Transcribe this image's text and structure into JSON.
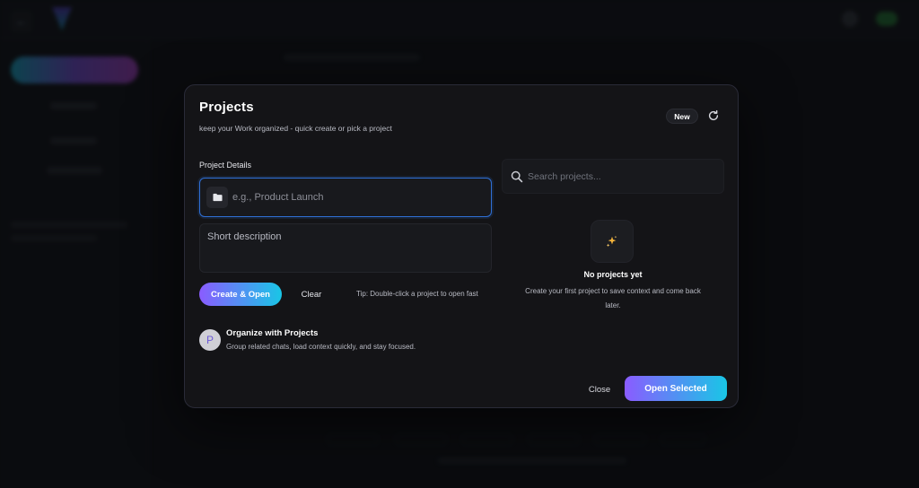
{
  "modal": {
    "title": "Projects",
    "subtitle": "keep your Work organized - quick create or pick a project",
    "new_label": "New",
    "section_label": "Project Details",
    "name_placeholder": "e.g., Product Launch",
    "desc_placeholder": "Short description",
    "create_label": "Create & Open",
    "clear_label": "Clear",
    "tip": "Tip: Double-click a project to open fast",
    "info": {
      "avatar_letter": "P",
      "title": "Organize with Projects",
      "desc": "Group related chats, load context quickly, and stay focused."
    },
    "search_placeholder": "Search projects...",
    "empty": {
      "title": "No projects yet",
      "desc": "Create your first project to save context and come back later."
    },
    "close_label": "Close",
    "open_selected_label": "Open Selected"
  },
  "icons": {
    "refresh": "refresh-icon",
    "folder": "folder-icon",
    "search": "search-icon",
    "sparkles": "sparkles-icon"
  },
  "colors": {
    "accent_start": "#8a5cff",
    "accent_end": "#19c6e6",
    "focus_border": "#2f6fd6",
    "modal_bg": "#141417"
  }
}
